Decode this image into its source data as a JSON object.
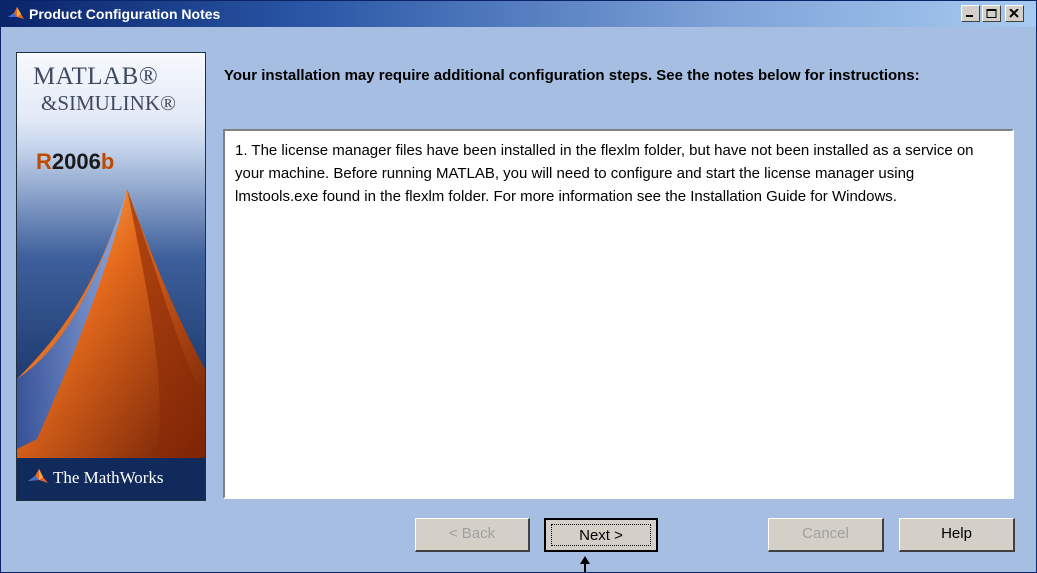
{
  "window": {
    "title": "Product Configuration Notes"
  },
  "branding": {
    "product_line1": "MATLAB®",
    "product_line2": "&SIMULINK®",
    "release_prefix": "R",
    "release_year": "2006",
    "release_suffix": "b",
    "company": "The MathWorks"
  },
  "main": {
    "instructions": "Your installation may require additional configuration steps.  See the notes below for instructions:",
    "notes": "1. The license manager files have been installed in the flexlm folder, but have not been installed as a service on your machine.  Before running MATLAB, you will need to configure and start the license manager using lmstools.exe found in the flexlm folder. For more information see the Installation Guide for Windows."
  },
  "buttons": {
    "back": "< Back",
    "next": "Next >",
    "cancel": "Cancel",
    "help": "Help"
  },
  "colors": {
    "title_bar_start": "#0a246a",
    "dialog_background": "#a6bee1",
    "button_face": "#d4d0c8",
    "disabled_text": "#a0a0a0"
  },
  "icons": {
    "title": "matlab-membrane-icon",
    "minimize": "minimize-icon",
    "maximize": "maximize-icon",
    "close": "close-icon"
  }
}
